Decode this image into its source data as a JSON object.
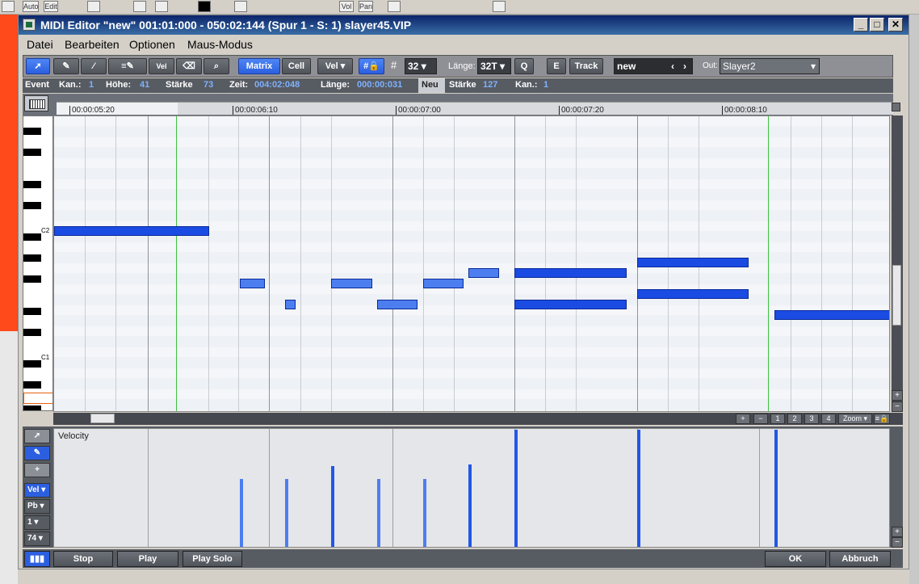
{
  "window": {
    "title": "MIDI Editor \"new\" 001:01:000 - 050:02:144 (Spur 1 - S:  1) slayer45.VIP"
  },
  "menu": [
    "Datei",
    "Bearbeiten",
    "Optionen",
    "Maus-Modus"
  ],
  "bg_toolbar": {
    "auto": "Auto",
    "edit": "Edit",
    "vol": "Vol",
    "pan": "Pan"
  },
  "toolbar": {
    "vel_tool": "Vel",
    "matrix": "Matrix",
    "cell": "Cell",
    "vel_dropdown": "Vel",
    "grid_value": "32",
    "laenge_label": "Länge:",
    "laenge_value": "32T",
    "q": "Q",
    "e": "E",
    "track": "Track",
    "name_value": "new",
    "out_label": "Out:",
    "out_value": "Slayer2"
  },
  "infobar": {
    "event": "Event",
    "kan_label": "Kan.:",
    "kan_value": "1",
    "hoehe_label": "Höhe:",
    "hoehe_value": "41",
    "staerke_label": "Stärke",
    "staerke_value": "73",
    "zeit_label": "Zeit:",
    "zeit_value": "004:02:048",
    "laenge_label": "Länge:",
    "laenge_value": "000:00:031",
    "neu": "Neu",
    "neu_staerke_label": "Stärke",
    "neu_staerke_value": "127",
    "neu_kan_label": "Kan.:",
    "neu_kan_value": "1"
  },
  "ruler": [
    "00:00:05:20",
    "00:00:06:10",
    "00:00:07:00",
    "00:00:07:20",
    "00:00:08:10"
  ],
  "keyboard": {
    "c2": "C2",
    "c1": "C1"
  },
  "zoom": {
    "plus": "+",
    "minus": "−",
    "z1": "1",
    "z2": "2",
    "z3": "3",
    "z4": "4",
    "zoom": "Zoom"
  },
  "velocity": {
    "label": "Velocity",
    "vel_select": "Vel",
    "pb_select": "Pb",
    "chan_select": "1",
    "value_select": "74"
  },
  "buttons": {
    "stop": "Stop",
    "play": "Play",
    "play_solo": "Play Solo",
    "ok": "OK",
    "abbruch": "Abbruch"
  },
  "colors": {
    "note": "#1a4be3",
    "note_light": "#4d7ef0",
    "accent": "#2c5fe0"
  }
}
